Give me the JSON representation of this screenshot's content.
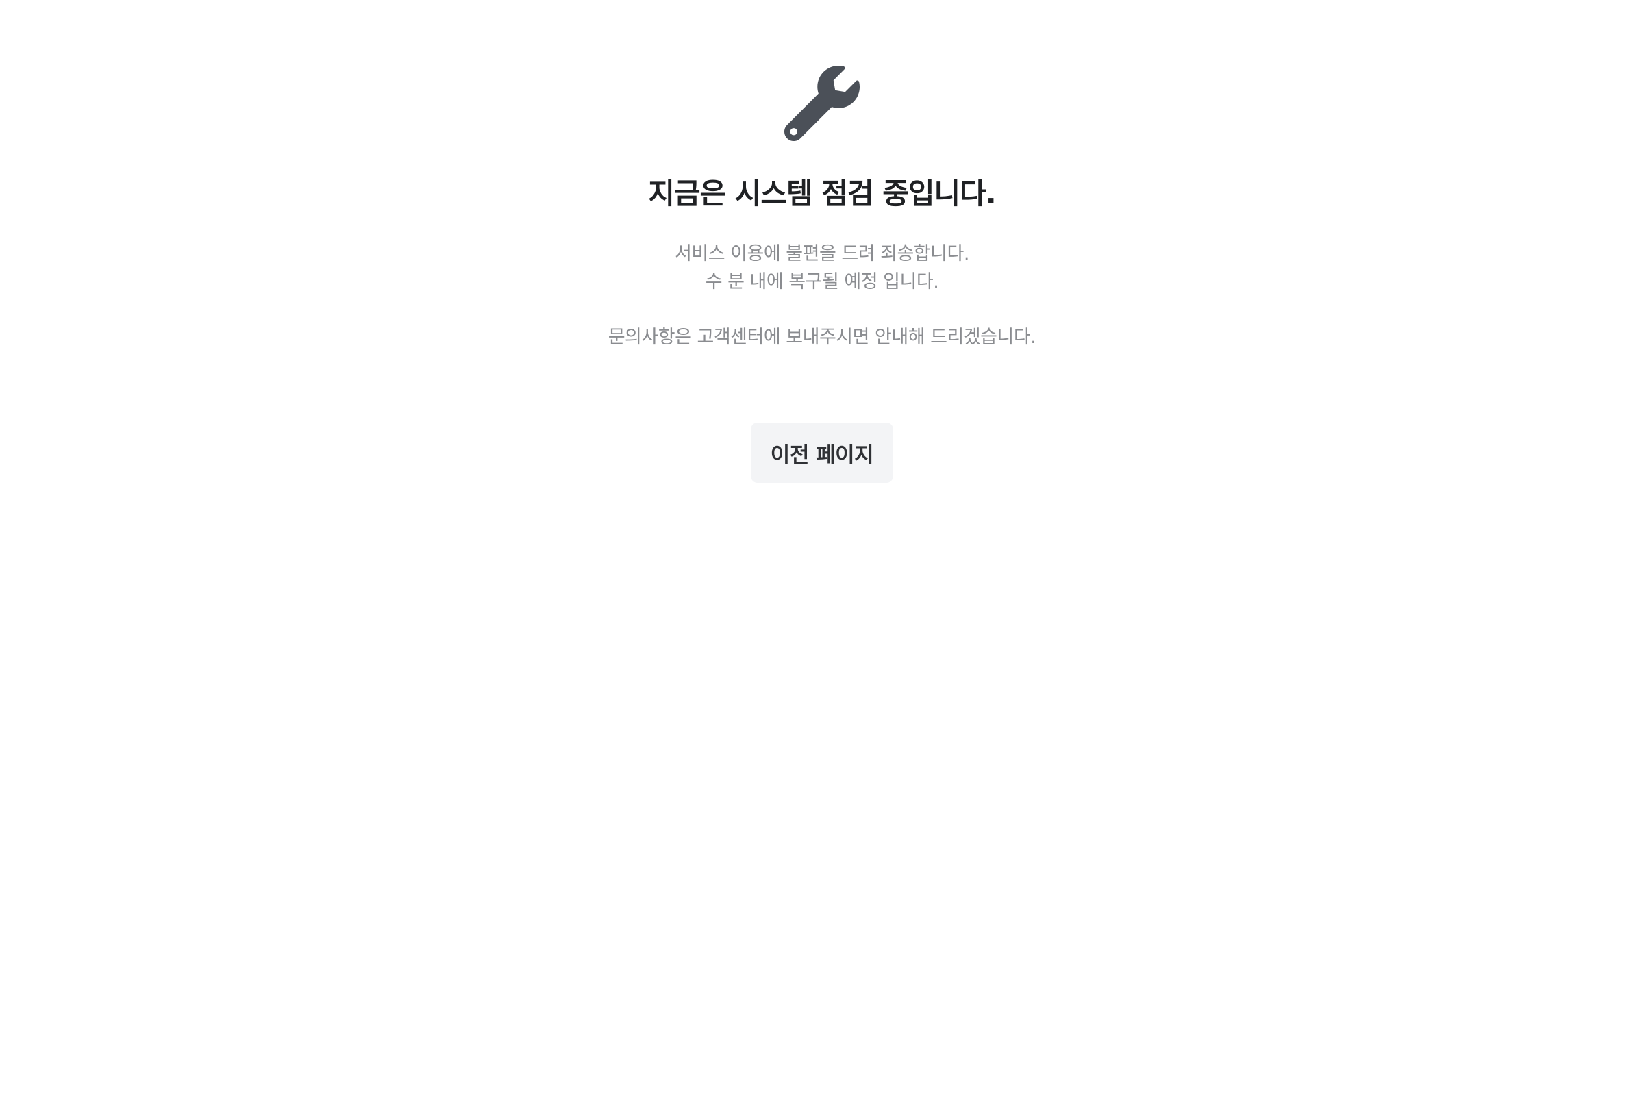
{
  "icon": {
    "name": "wrench-icon",
    "color": "#4b5058"
  },
  "title": "지금은 시스템 점검 중입니다.",
  "description": {
    "line1": "서비스 이용에 불편을 드려 죄송합니다.",
    "line2": "수 분 내에 복구될 예정 입니다."
  },
  "contact": "문의사항은 고객센터에 보내주시면 안내해 드리겠습니다.",
  "back_button": {
    "label": "이전 페이지"
  },
  "colors": {
    "title": "#1f2124",
    "text_secondary": "#8a8c90",
    "button_bg": "#f3f4f6",
    "button_text": "#2f3135"
  }
}
